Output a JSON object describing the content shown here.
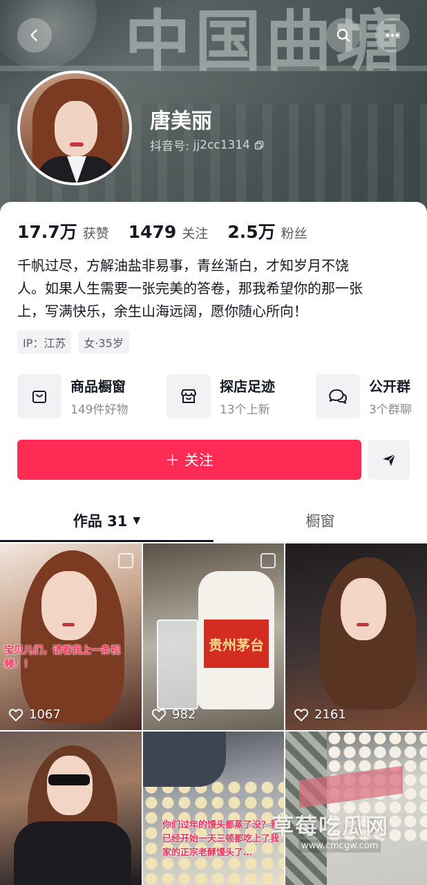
{
  "header": {
    "banner_sign_text": "中国曲塘"
  },
  "profile": {
    "name": "唐美丽",
    "douyin_id_label": "抖音号:",
    "douyin_id": "jj2cc1314",
    "stats": [
      {
        "value": "17.7万",
        "label": "获赞"
      },
      {
        "value": "1479",
        "label": "关注"
      },
      {
        "value": "2.5万",
        "label": "粉丝"
      }
    ],
    "bio_lines": [
      "千帆过尽，方解油盐非易事，青丝渐白，才知岁月不饶",
      "人。如果人生需要一张完美的答卷，那我希望你的那一张",
      "上，写满快乐，余生山海远阔，愿你随心所向！"
    ],
    "tags": [
      "IP：江苏",
      "女·35岁"
    ]
  },
  "features": [
    {
      "icon": "shopping-bag-icon",
      "title": "商品橱窗",
      "subtitle": "149件好物"
    },
    {
      "icon": "store-icon",
      "title": "探店足迹",
      "subtitle": "13个上新"
    },
    {
      "icon": "chat-bubbles-icon",
      "title": "公开群",
      "subtitle": "3个群聊"
    }
  ],
  "actions": {
    "follow_label": "＋ 关注",
    "share_icon": "send-icon"
  },
  "tabs": {
    "works_label": "作品 31",
    "window_label": "橱窗"
  },
  "videos": [
    {
      "likes": "1067",
      "overlay": "宝贝儿们，请看我上一条视频！！"
    },
    {
      "likes": "982",
      "overlay": "",
      "label": "贵州茅台"
    },
    {
      "likes": "2161",
      "overlay": ""
    },
    {
      "likes": "",
      "overlay": ""
    },
    {
      "likes": "",
      "overlay": "你们过年的馒头都蒸了没？我已经开始一天三顿都吃上了我家的正宗老酵馒头了…"
    },
    {
      "likes": "",
      "overlay": ""
    }
  ],
  "watermark": {
    "text": "草莓吃瓜网",
    "url": "www.cmcgw.com"
  },
  "colors": {
    "accent": "#fe2c55",
    "text_primary": "#161823",
    "text_secondary": "#5a5c63"
  }
}
